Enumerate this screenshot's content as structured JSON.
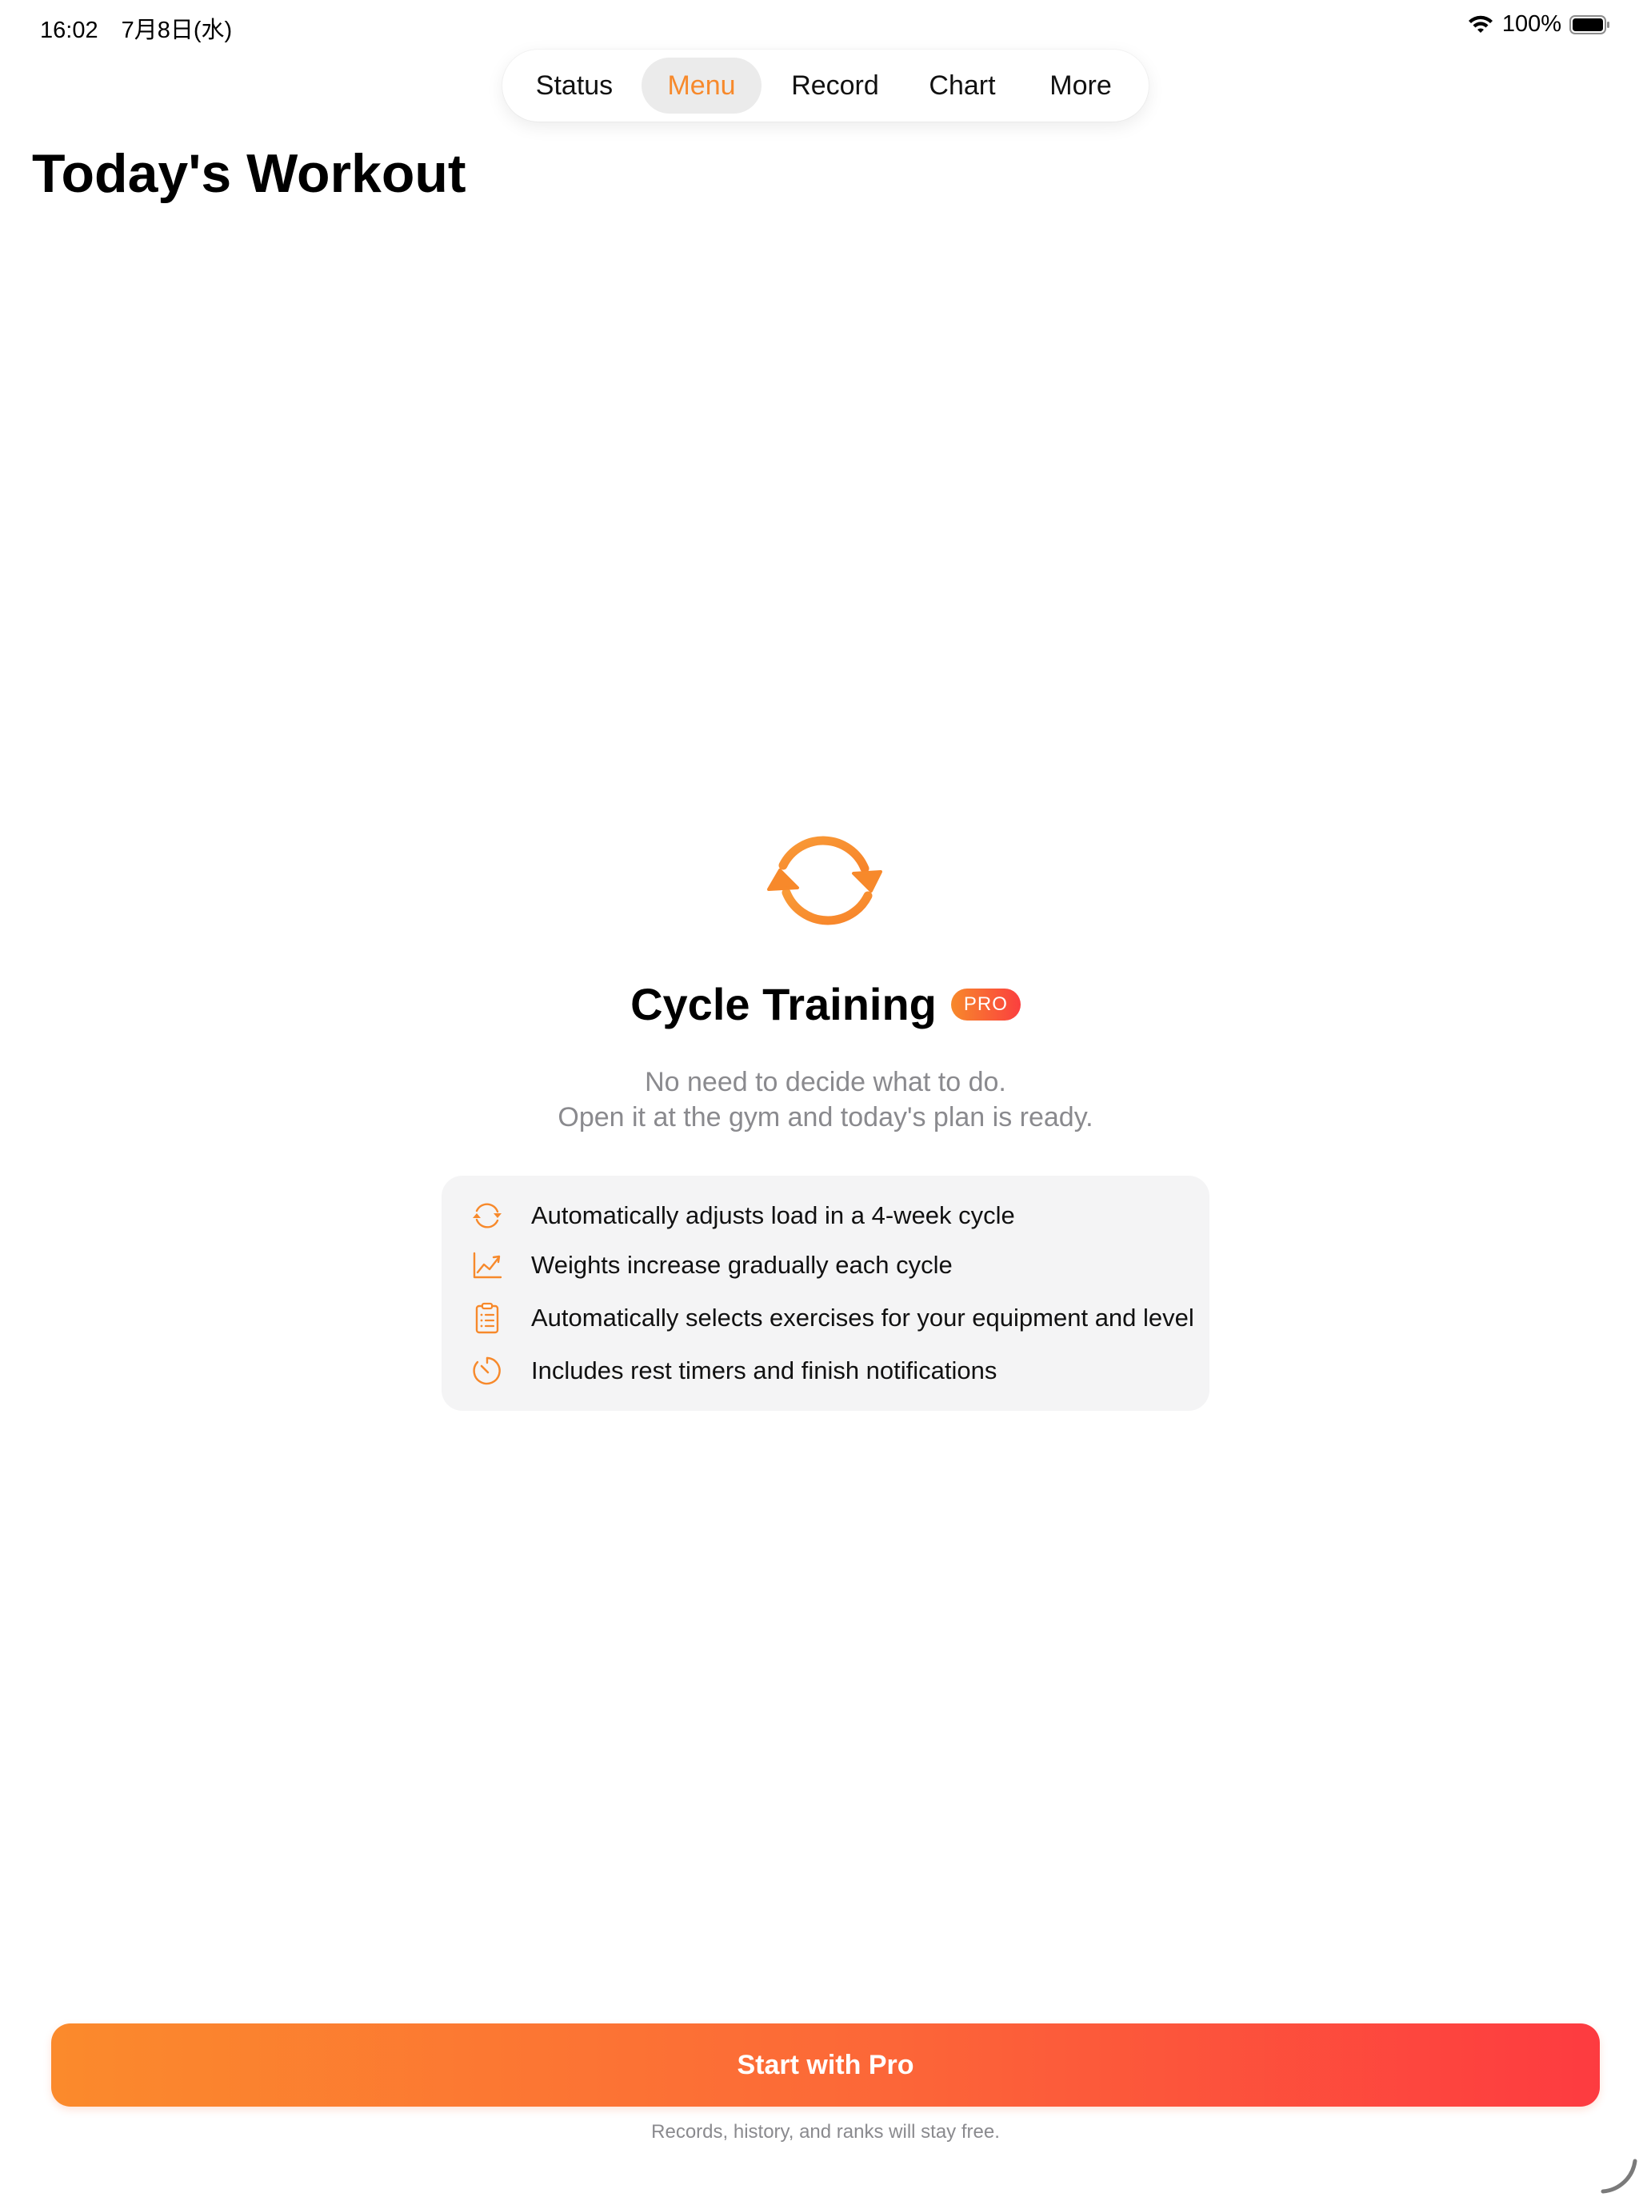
{
  "status_bar": {
    "time": "16:02　7月8日(水)",
    "battery": "100%"
  },
  "tabs": [
    {
      "label": "Status",
      "active": false
    },
    {
      "label": "Menu",
      "active": true
    },
    {
      "label": "Record",
      "active": false
    },
    {
      "label": "Chart",
      "active": false
    },
    {
      "label": "More",
      "active": false
    }
  ],
  "page": {
    "title": "Today's Workout"
  },
  "hero": {
    "icon": "cycle-arrows-icon",
    "title": "Cycle Training",
    "badge": "PRO",
    "subtitle_line1": "No need to decide what to do.",
    "subtitle_line2": "Open it at the gym and today's plan is ready."
  },
  "features": [
    {
      "icon": "cycle-arrows-icon",
      "text": "Automatically adjusts load in a 4-week cycle"
    },
    {
      "icon": "trend-chart-icon",
      "text": "Weights increase gradually each cycle"
    },
    {
      "icon": "clipboard-icon",
      "text": "Automatically selects exercises for your equipment and level"
    },
    {
      "icon": "timer-icon",
      "text": "Includes rest timers and finish notifications"
    }
  ],
  "cta": {
    "label": "Start with Pro",
    "footnote": "Records, history, and ranks will stay free."
  },
  "colors": {
    "accent": "#f7892b",
    "gradient_start": "#fb8a2c",
    "gradient_end": "#fd3b40",
    "muted_text": "#8a8a8e",
    "card_bg": "#f4f4f5"
  }
}
